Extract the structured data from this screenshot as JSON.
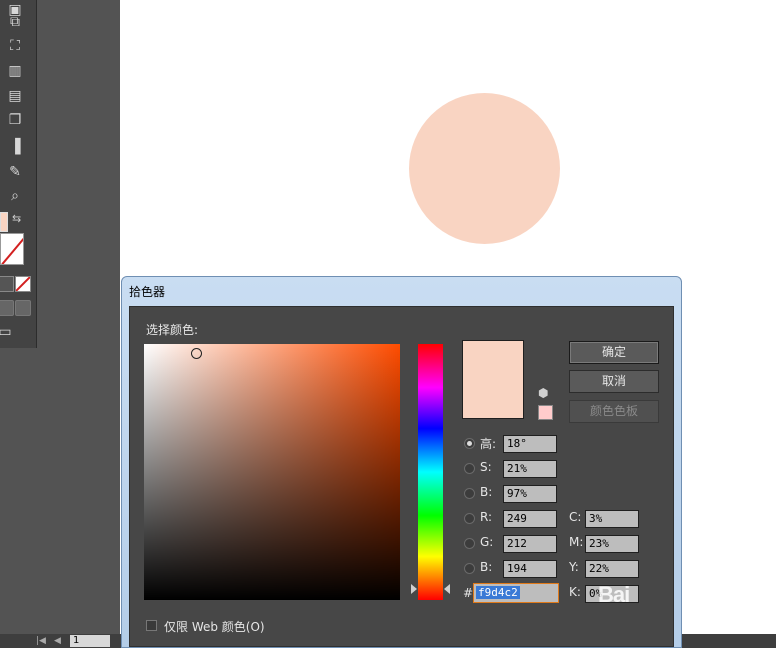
{
  "canvas": {
    "shape_color": "#f9d4c2"
  },
  "status_bar": {
    "page_value": "1"
  },
  "dialog": {
    "title": "拾色器",
    "select_color_label": "选择颜色:",
    "current_color": "#f9d4c2",
    "hue_base_color": "#ff4c00",
    "buttons": {
      "ok": "确定",
      "cancel": "取消",
      "swatches": "颜色色板"
    },
    "hsb": [
      {
        "label": "高:",
        "value": "18°"
      },
      {
        "label": "S:",
        "value": "21%"
      },
      {
        "label": "B:",
        "value": "97%"
      }
    ],
    "rgb": [
      {
        "label": "R:",
        "value": "249"
      },
      {
        "label": "G:",
        "value": "212"
      },
      {
        "label": "B:",
        "value": "194"
      }
    ],
    "cmyk": [
      {
        "label": "C:",
        "value": "3%"
      },
      {
        "label": "M:",
        "value": "23%"
      },
      {
        "label": "Y:",
        "value": "22%"
      },
      {
        "label": "K:",
        "value": "0%"
      }
    ],
    "hex_prefix": "#",
    "hex_value": "f9d4c2",
    "web_only_label": "仅限 Web 颜色(O)"
  },
  "watermark": "Bai"
}
